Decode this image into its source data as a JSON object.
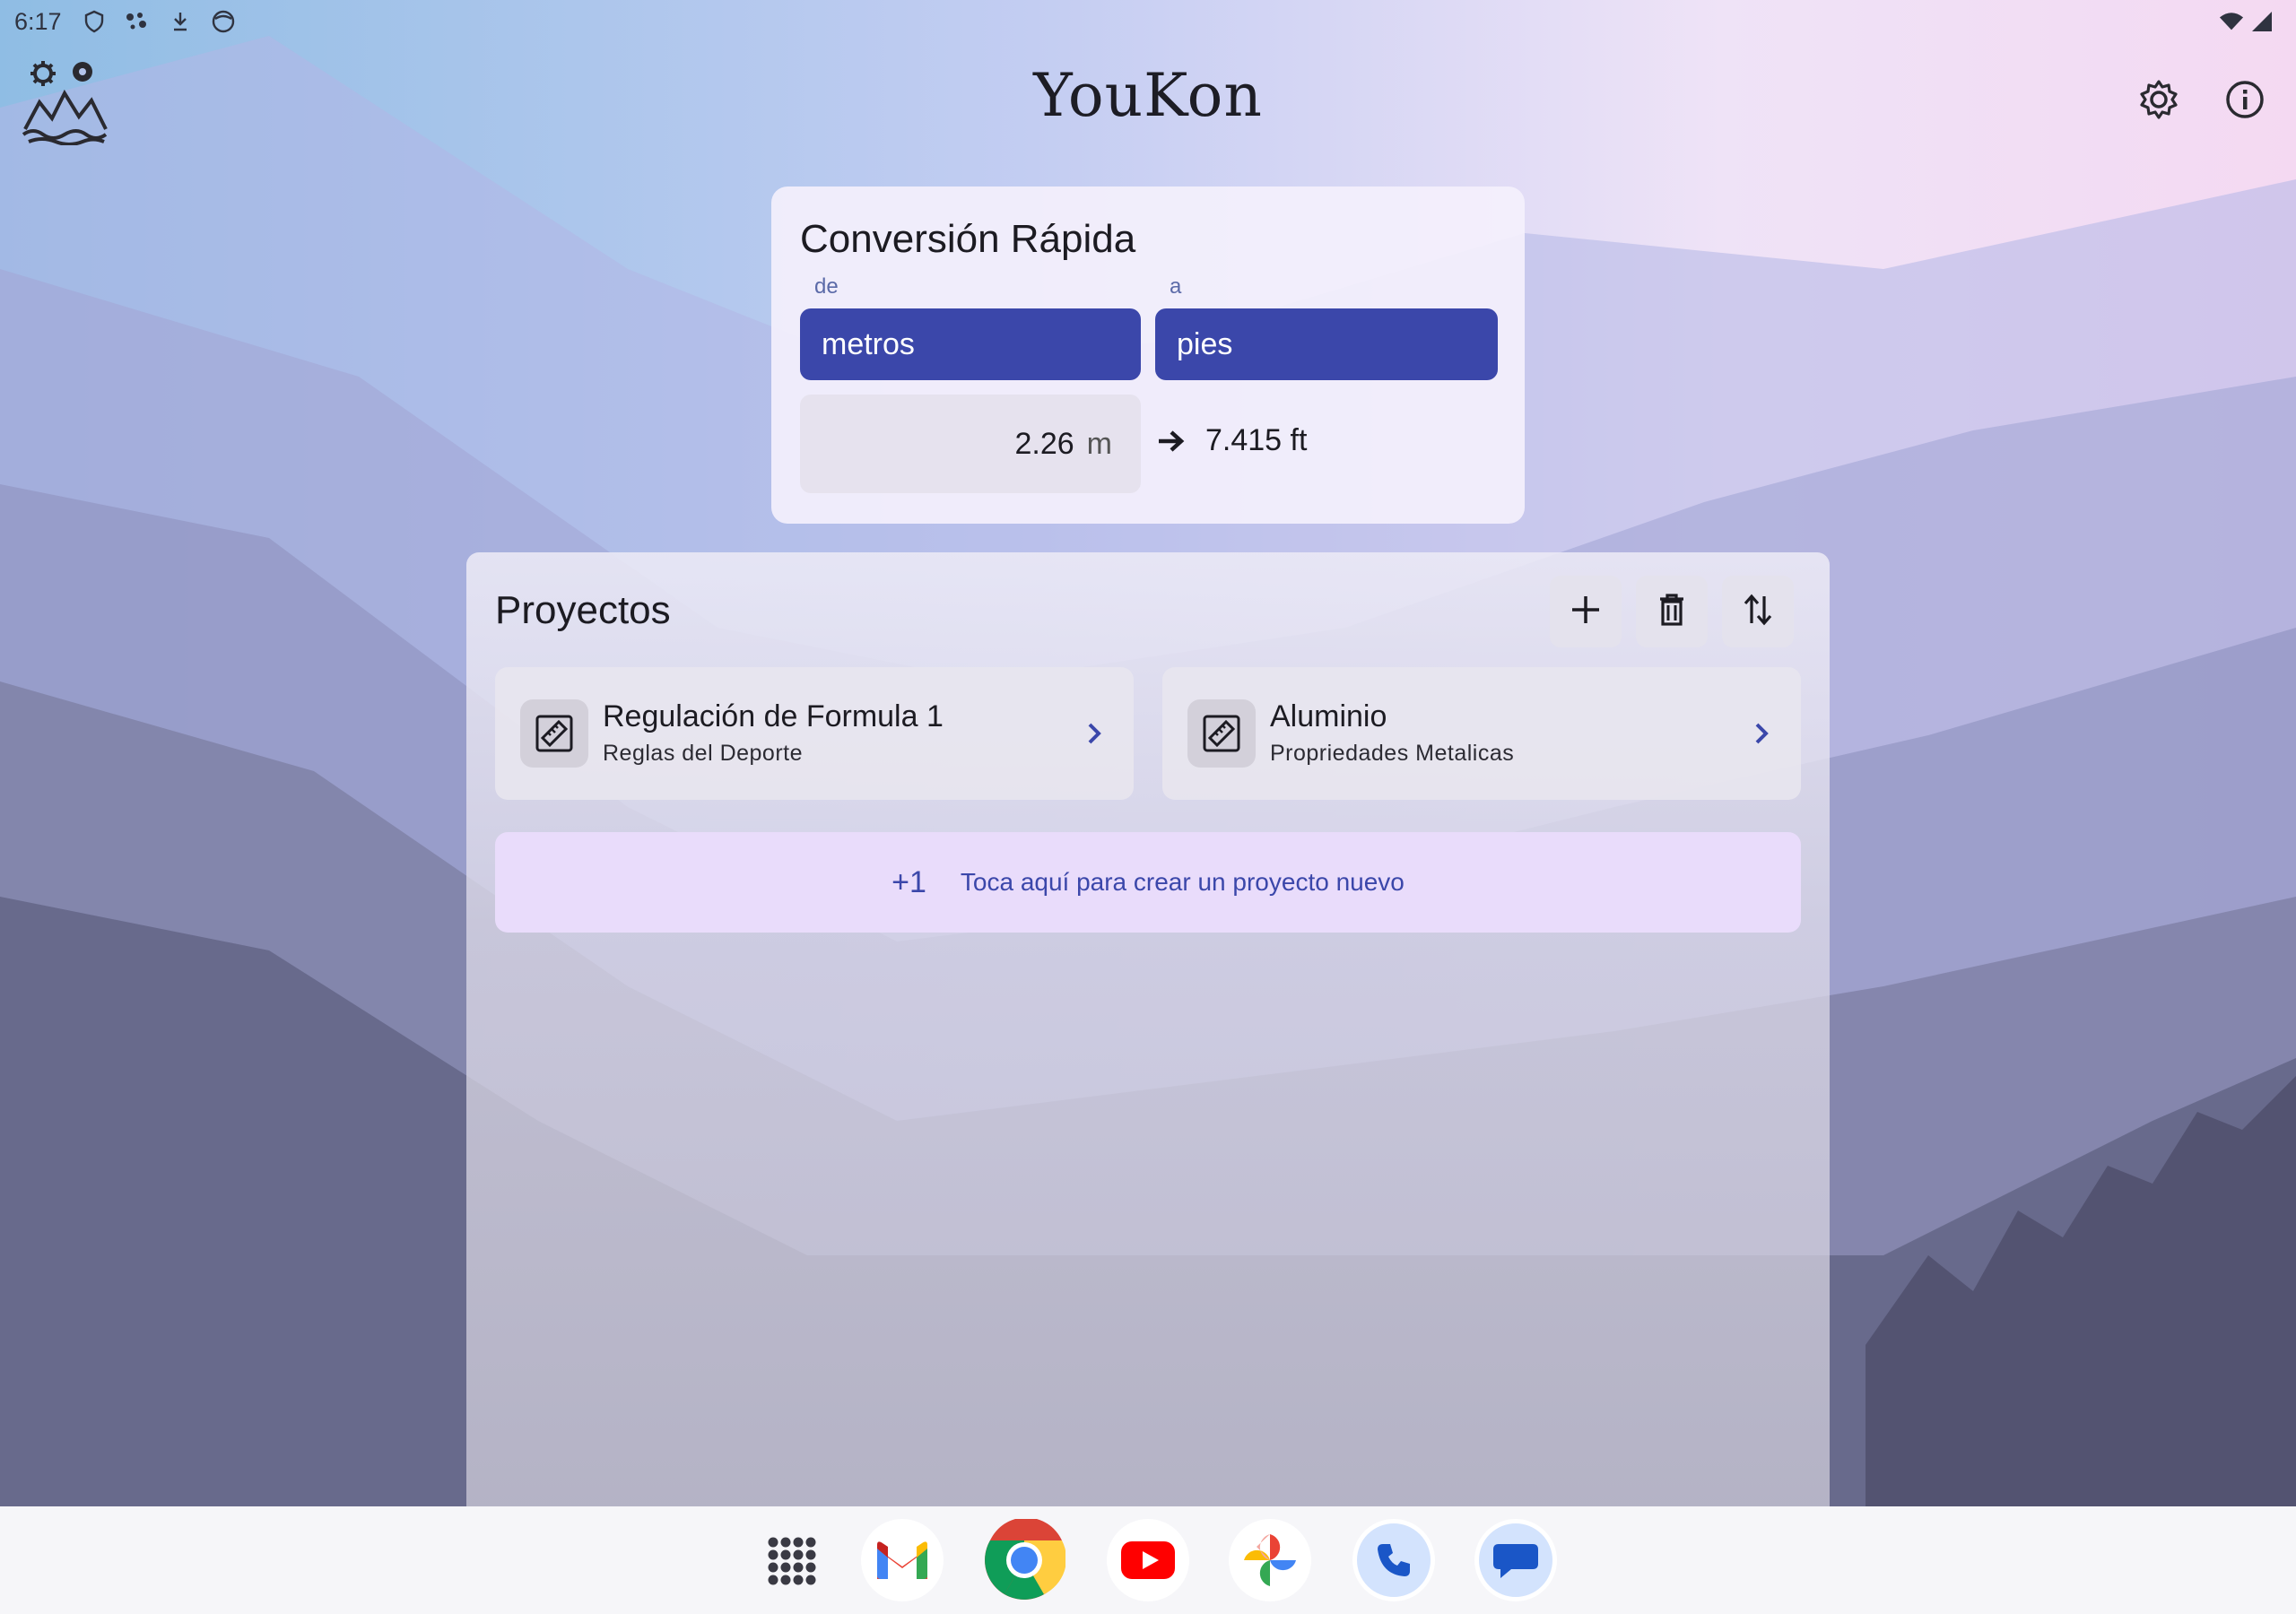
{
  "status_bar": {
    "time": "6:17",
    "left_icons": [
      "shield-icon",
      "assistant-dots-icon",
      "download-icon",
      "face-icon"
    ],
    "right_icons": [
      "wifi-icon",
      "cell-signal-icon"
    ]
  },
  "app_bar": {
    "title": "YouKon",
    "logo_icon": "mountains-gears-logo-icon",
    "actions": [
      "settings-icon",
      "info-icon"
    ]
  },
  "quick_conversion": {
    "title": "Conversión Rápida",
    "from_label": "de",
    "to_label": "a",
    "from_unit": "metros",
    "to_unit": "pies",
    "input_value": "2.26",
    "input_unit": "m",
    "result": "7.415 ft"
  },
  "projects": {
    "title": "Proyectos",
    "actions": [
      "add-icon",
      "delete-icon",
      "sort-icon"
    ],
    "items": [
      {
        "name": "Regulación de Formula 1",
        "subtitle": "Reglas del Deporte",
        "icon": "ruler-icon"
      },
      {
        "name": "Aluminio",
        "subtitle": "Propriedades Metalicas",
        "icon": "ruler-icon"
      }
    ],
    "new_project": {
      "badge": "+1",
      "text": "Toca aquí para crear un proyecto nuevo"
    }
  },
  "dock": {
    "apps": [
      "app-drawer-icon",
      "gmail-icon",
      "chrome-icon",
      "youtube-icon",
      "photos-icon",
      "phone-icon",
      "messages-icon"
    ]
  },
  "colors": {
    "accent": "#3b47aa",
    "card": "#f4f0fc",
    "new_project_bg": "#e9dcfb",
    "text": "#1c1b22"
  }
}
